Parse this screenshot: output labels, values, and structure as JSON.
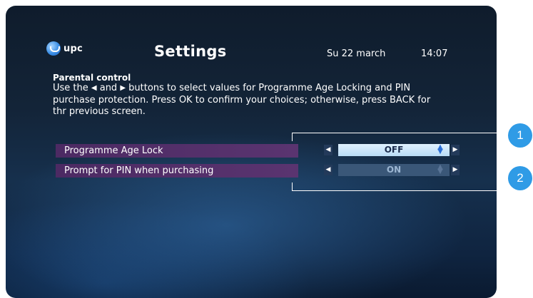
{
  "header": {
    "logo_text": "upc",
    "title": "Settings",
    "date": "Su 22 march",
    "time": "14:07"
  },
  "section": {
    "title": "Parental control",
    "instr_part1": "Use the ",
    "left_glyph": "◀",
    "instr_part2": " and ",
    "right_glyph": "▶",
    "instr_part3": " buttons to select values for Programme Age Locking and PIN purchase protection. Press OK to confirm your choices; otherwise, press BACK for thr previous screen."
  },
  "settings": [
    {
      "label": "Programme Age Lock",
      "value": "OFF",
      "selected": true
    },
    {
      "label": "Prompt for PIN when purchasing",
      "value": "ON",
      "selected": false
    }
  ],
  "callouts": [
    "1",
    "2"
  ],
  "icons": {
    "left_arrow": "◀",
    "right_arrow": "▶",
    "updown": "▲▼"
  },
  "colors": {
    "row_bg": "#4c2a63",
    "selected_value_bg": "#cfe8fb",
    "callout_accent": "#2f9be6"
  }
}
